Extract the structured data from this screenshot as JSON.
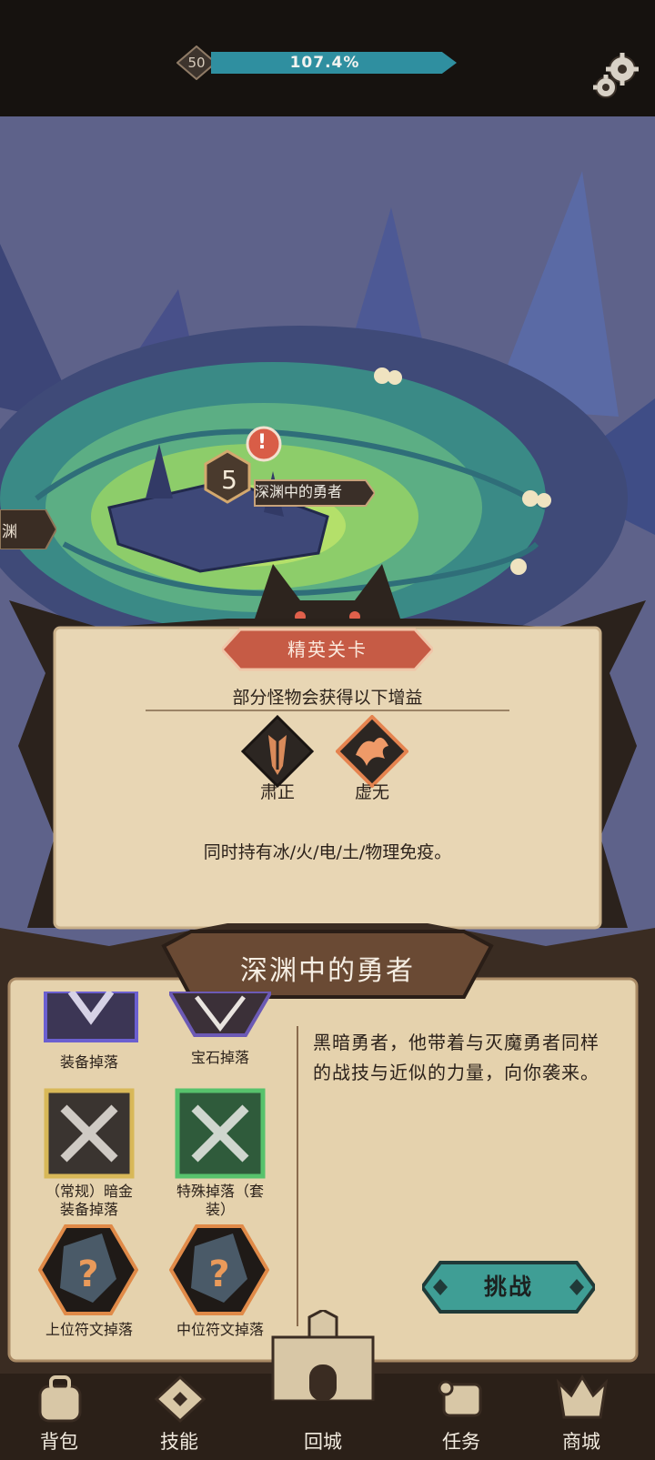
{
  "player": {
    "level": "50",
    "xp_percent_label": "107.4%",
    "xp_fill": 1.0
  },
  "map": {
    "side_tag": "渊",
    "stage": {
      "number": "5",
      "name": "深渊中的勇者",
      "alert": "!"
    }
  },
  "elite": {
    "banner": "精英关卡",
    "subtitle": "部分怪物会获得以下增益",
    "buffs": [
      {
        "name": "肃正",
        "icon": "dark-pillar-icon"
      },
      {
        "name": "虚无",
        "icon": "void-flame-icon"
      }
    ],
    "description": "同时持有冰/火/电/土/物理免疫。"
  },
  "stage_info": {
    "title": "深渊中的勇者",
    "drops": [
      {
        "label": "装备掉落",
        "icon": "equipment-icon"
      },
      {
        "label": "宝石掉落",
        "icon": "gem-icon"
      },
      {
        "label": "（常规）暗金装备掉落",
        "line1": "（常规）暗金",
        "line2": "装备掉落",
        "icon": "dark-gold-crossed-swords-icon"
      },
      {
        "label": "特殊掉落（套装）",
        "line1": "特殊掉落（套",
        "line2": "装）",
        "icon": "set-crossed-swords-icon"
      },
      {
        "label": "上位符文掉落",
        "icon": "rune-unknown-icon"
      },
      {
        "label": "中位符文掉落",
        "icon": "rune-unknown-icon"
      }
    ],
    "story": "黑暗勇者，他带着与灭魔勇者同样的战技与近似的力量，向你袭来。",
    "challenge": "挑战"
  },
  "nav": [
    {
      "label": "背包",
      "icon": "backpack-icon"
    },
    {
      "label": "技能",
      "icon": "skill-icon"
    },
    {
      "label": "回城",
      "icon": "castle-icon"
    },
    {
      "label": "任务",
      "icon": "scroll-icon"
    },
    {
      "label": "商城",
      "icon": "shop-crown-icon"
    }
  ],
  "colors": {
    "xp": "#2f8fa0",
    "elite_banner": "#c65b45",
    "challenge": "#3f9e95",
    "parchment": "#e9d8b8"
  }
}
